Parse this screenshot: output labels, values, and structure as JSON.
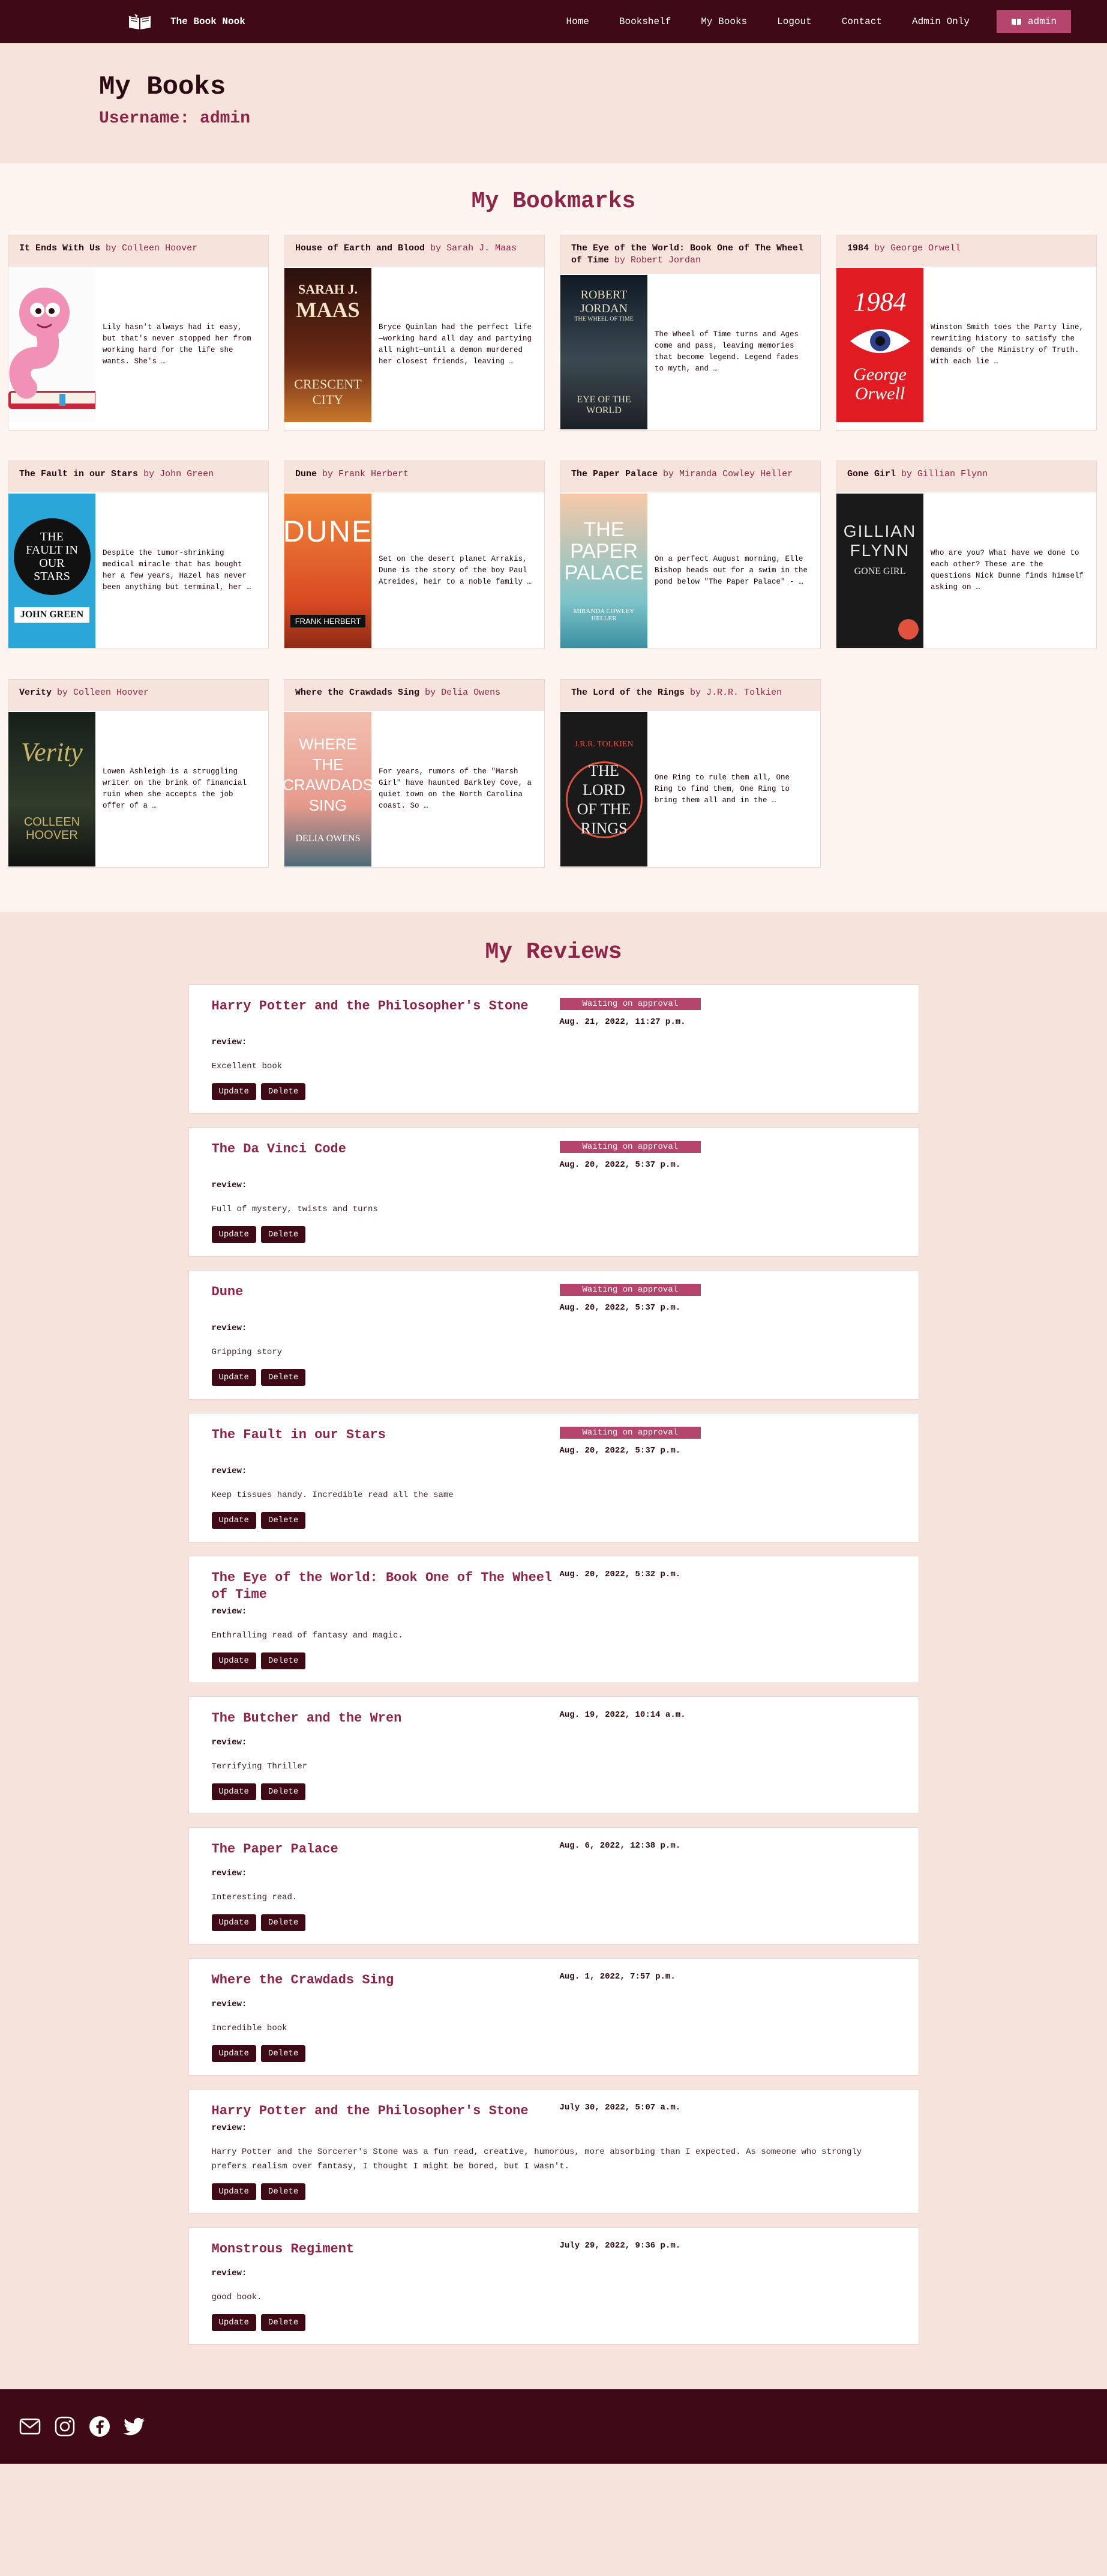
{
  "nav": {
    "brand": "The Book Nook",
    "links": [
      "Home",
      "Bookshelf",
      "My Books",
      "Logout",
      "Contact",
      "Admin Only"
    ],
    "user_button": "admin"
  },
  "hero": {
    "title": "My Books",
    "username": "Username: admin"
  },
  "bookmarks": {
    "title": "My Bookmarks",
    "items": [
      {
        "title": "It Ends With Us",
        "by": "by Colleen Hoover",
        "desc": "Lily hasn't always had it easy, but that's never stopped her from working hard for the life she wants. She's …",
        "cover": {
          "bg": "#fbfbfb"
        }
      },
      {
        "title": "House of Earth and Blood",
        "by": "by Sarah J. Maas",
        "desc": "Bryce Quinlan had the perfect life—working hard all day and partying all night—until a demon murdered her closest friends, leaving …",
        "cover": {
          "top": "SARAH J.",
          "mid": "MAAS",
          "bottom": "CRESCENT CITY",
          "bg": "#3b1712"
        }
      },
      {
        "title": "The Eye of the World: Book One of The Wheel of Time",
        "by": "by Robert Jordan",
        "desc": "The Wheel of Time turns and Ages come and pass, leaving memories that become legend. Legend fades to myth, and …",
        "cover": {
          "top": "ROBERT JORDAN",
          "mid": "THE WHEEL OF TIME",
          "bottom": "EYE OF THE WORLD",
          "bg": "#1e2a33"
        }
      },
      {
        "title": "1984",
        "by": "by George Orwell",
        "desc": "Winston Smith toes the Party line, rewriting history to satisfy the demands of the Ministry of Truth. With each lie …",
        "cover": {
          "top": "1984",
          "bottom": "George Orwell",
          "bg": "#e11b22"
        }
      },
      {
        "title": "The Fault in our Stars",
        "by": "by John Green",
        "desc": "Despite the tumor-shrinking medical miracle that has bought her a few years, Hazel has never been anything but terminal, her …",
        "cover": {
          "top": "THE FAULT IN OUR STARS",
          "bottom": "JOHN GREEN",
          "bg": "#2aa6d8"
        }
      },
      {
        "title": "Dune",
        "by": "by Frank Herbert",
        "desc": "Set on the desert planet Arrakis, Dune is the story of the boy Paul Atreides, heir to a noble family …",
        "cover": {
          "top": "DUNE",
          "bottom": "FRANK HERBERT",
          "bg": "#e2582a"
        }
      },
      {
        "title": "The Paper Palace",
        "by": "by Miranda Cowley Heller",
        "desc": "On a perfect August morning, Elle Bishop heads out for a swim in the pond below \"The Paper Palace\" - …",
        "cover": {
          "top": "THE PAPER PALACE",
          "bottom": "MIRANDA COWLEY HELLER",
          "bg": "#7cc4c9"
        }
      },
      {
        "title": "Gone Girl",
        "by": "by Gillian Flynn",
        "desc": "Who are you? What have we done to each other? These are the questions Nick Dunne finds himself asking on …",
        "cover": {
          "top": "GILLIAN FLYNN",
          "bottom": "GONE GIRL",
          "bg": "#1a1a1a"
        }
      },
      {
        "title": "Verity",
        "by": "by Colleen Hoover",
        "desc": "Lowen Ashleigh is a struggling writer on the brink of financial ruin when she accepts the job offer of a …",
        "cover": {
          "top": "Verity",
          "bottom": "COLLEEN HOOVER",
          "bg": "#1f2a1c"
        }
      },
      {
        "title": "Where the Crawdads Sing",
        "by": "by Delia Owens",
        "desc": "For years, rumors of the \"Marsh Girl\" have haunted Barkley Cove, a quiet town on the North Carolina coast. So …",
        "cover": {
          "top": "WHERE THE CRAWDADS SING",
          "bottom": "DELIA OWENS",
          "bg": "#e9a89a"
        }
      },
      {
        "title": "The Lord of the Rings",
        "by": "by J.R.R. Tolkien",
        "desc": "One Ring to rule them all, One Ring to find them, One Ring to bring them all and in the …",
        "cover": {
          "top": "J.R.R. TOLKIEN",
          "mid": "THE LORD OF THE RINGS",
          "bg": "#1a1a1a"
        }
      }
    ]
  },
  "reviews": {
    "title": "My Reviews",
    "review_label": "review:",
    "update_label": "Update",
    "delete_label": "Delete",
    "items": [
      {
        "title": "Harry Potter and the Philosopher's Stone",
        "status": "Waiting on approval",
        "date": "Aug. 21, 2022, 11:27 p.m.",
        "text": "Excellent book"
      },
      {
        "title": "The Da Vinci Code",
        "status": "Waiting on approval",
        "date": "Aug. 20, 2022, 5:37 p.m.",
        "text": "Full of mystery, twists and turns"
      },
      {
        "title": "Dune",
        "status": "Waiting on approval",
        "date": "Aug. 20, 2022, 5:37 p.m.",
        "text": "Gripping story"
      },
      {
        "title": "The Fault in our Stars",
        "status": "Waiting on approval",
        "date": "Aug. 20, 2022, 5:37 p.m.",
        "text": "Keep tissues handy. Incredible read all the same"
      },
      {
        "title": "The Eye of the World: Book One of The Wheel of Time",
        "status": "",
        "date": "Aug. 20, 2022, 5:32 p.m.",
        "text": "Enthralling read of fantasy and magic."
      },
      {
        "title": "The Butcher and the Wren",
        "status": "",
        "date": "Aug. 19, 2022, 10:14 a.m.",
        "text": "Terrifying Thriller"
      },
      {
        "title": "The Paper Palace",
        "status": "",
        "date": "Aug. 6, 2022, 12:38 p.m.",
        "text": "Interesting read."
      },
      {
        "title": "Where the Crawdads Sing",
        "status": "",
        "date": "Aug. 1, 2022, 7:57 p.m.",
        "text": "Incredible book"
      },
      {
        "title": "Harry Potter and the Philosopher's Stone",
        "status": "",
        "date": "July 30, 2022, 5:07 a.m.",
        "text": "Harry Potter and the Sorcerer's Stone was a fun read, creative, humorous, more absorbing than I expected. As someone who strongly prefers realism over fantasy, I thought I might be bored, but I wasn't."
      },
      {
        "title": "Monstrous Regiment",
        "status": "",
        "date": "July 29, 2022, 9:36 p.m.",
        "text": "good book."
      }
    ]
  },
  "footer": {
    "icons": [
      "mail-icon",
      "instagram-icon",
      "facebook-icon",
      "twitter-icon"
    ]
  }
}
